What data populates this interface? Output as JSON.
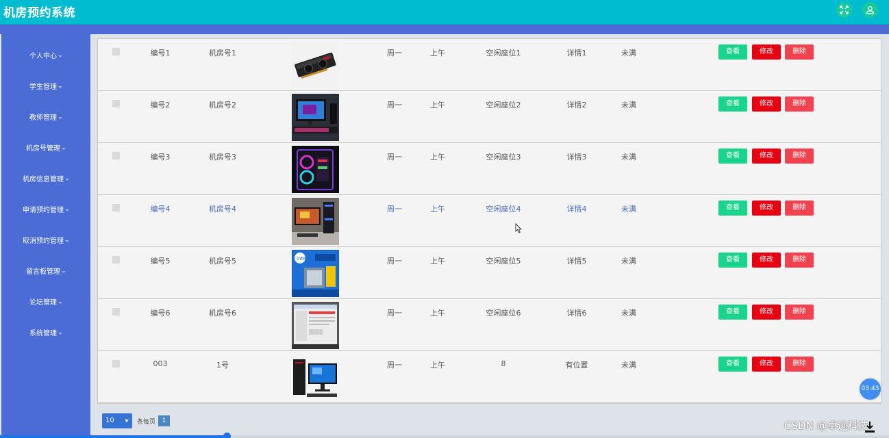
{
  "app": {
    "title": "机房预约系统"
  },
  "header": {
    "icons": [
      "fullscreen-icon",
      "user-icon"
    ]
  },
  "sidebar": {
    "items": [
      {
        "label": "个人中心"
      },
      {
        "label": "学生管理"
      },
      {
        "label": "教师管理"
      },
      {
        "label": "机房号管理"
      },
      {
        "label": "机房信息管理"
      },
      {
        "label": "申请预约管理"
      },
      {
        "label": "取消预约管理"
      },
      {
        "label": "留言板管理"
      },
      {
        "label": "论坛管理"
      },
      {
        "label": "系统管理"
      }
    ]
  },
  "table": {
    "actions": {
      "view": "查看",
      "edit": "修改",
      "delete": "删除"
    },
    "rows": [
      {
        "id": "编号1",
        "room": "机房号1",
        "day": "周一",
        "period": "上午",
        "seat": "空闲座位1",
        "detail": "详情1",
        "status": "未满",
        "image": "graphics-card"
      },
      {
        "id": "编号2",
        "room": "机房号2",
        "day": "周一",
        "period": "上午",
        "seat": "空闲座位2",
        "detail": "详情2",
        "status": "未满",
        "image": "monitor-setup"
      },
      {
        "id": "编号3",
        "room": "机房号3",
        "day": "周一",
        "period": "上午",
        "seat": "空闲座位3",
        "detail": "详情3",
        "status": "未满",
        "image": "rgb-pc-case"
      },
      {
        "id": "编号4",
        "room": "机房号4",
        "day": "周一",
        "period": "上午",
        "seat": "空闲座位4",
        "detail": "详情4",
        "status": "未满",
        "image": "desktop-workstation",
        "highlighted": true
      },
      {
        "id": "编号5",
        "room": "机房号5",
        "day": "周一",
        "period": "上午",
        "seat": "空闲座位5",
        "detail": "详情5",
        "status": "未满",
        "image": "intel-cpu-box"
      },
      {
        "id": "编号6",
        "room": "机房号6",
        "day": "周一",
        "period": "上午",
        "seat": "空闲座位6",
        "detail": "详情6",
        "status": "未满",
        "image": "software-screenshot"
      },
      {
        "id": "003",
        "room": "1号",
        "day": "周一",
        "period": "上午",
        "seat": "8",
        "detail": "有位置",
        "status": "未满",
        "image": "pc-and-monitor"
      }
    ]
  },
  "pagination": {
    "page_size": "10",
    "per_page_label": "条每页",
    "current_page": "1"
  },
  "overlay": {
    "timer": "03:43",
    "watermark": "CSDN @卓远科技",
    "video_progress": 0.255
  },
  "colors": {
    "topbar": "#00bcd0",
    "sidebar": "#4a6cd4",
    "view": "#1ad38c",
    "edit": "#e60012",
    "delete": "#f2424f"
  }
}
